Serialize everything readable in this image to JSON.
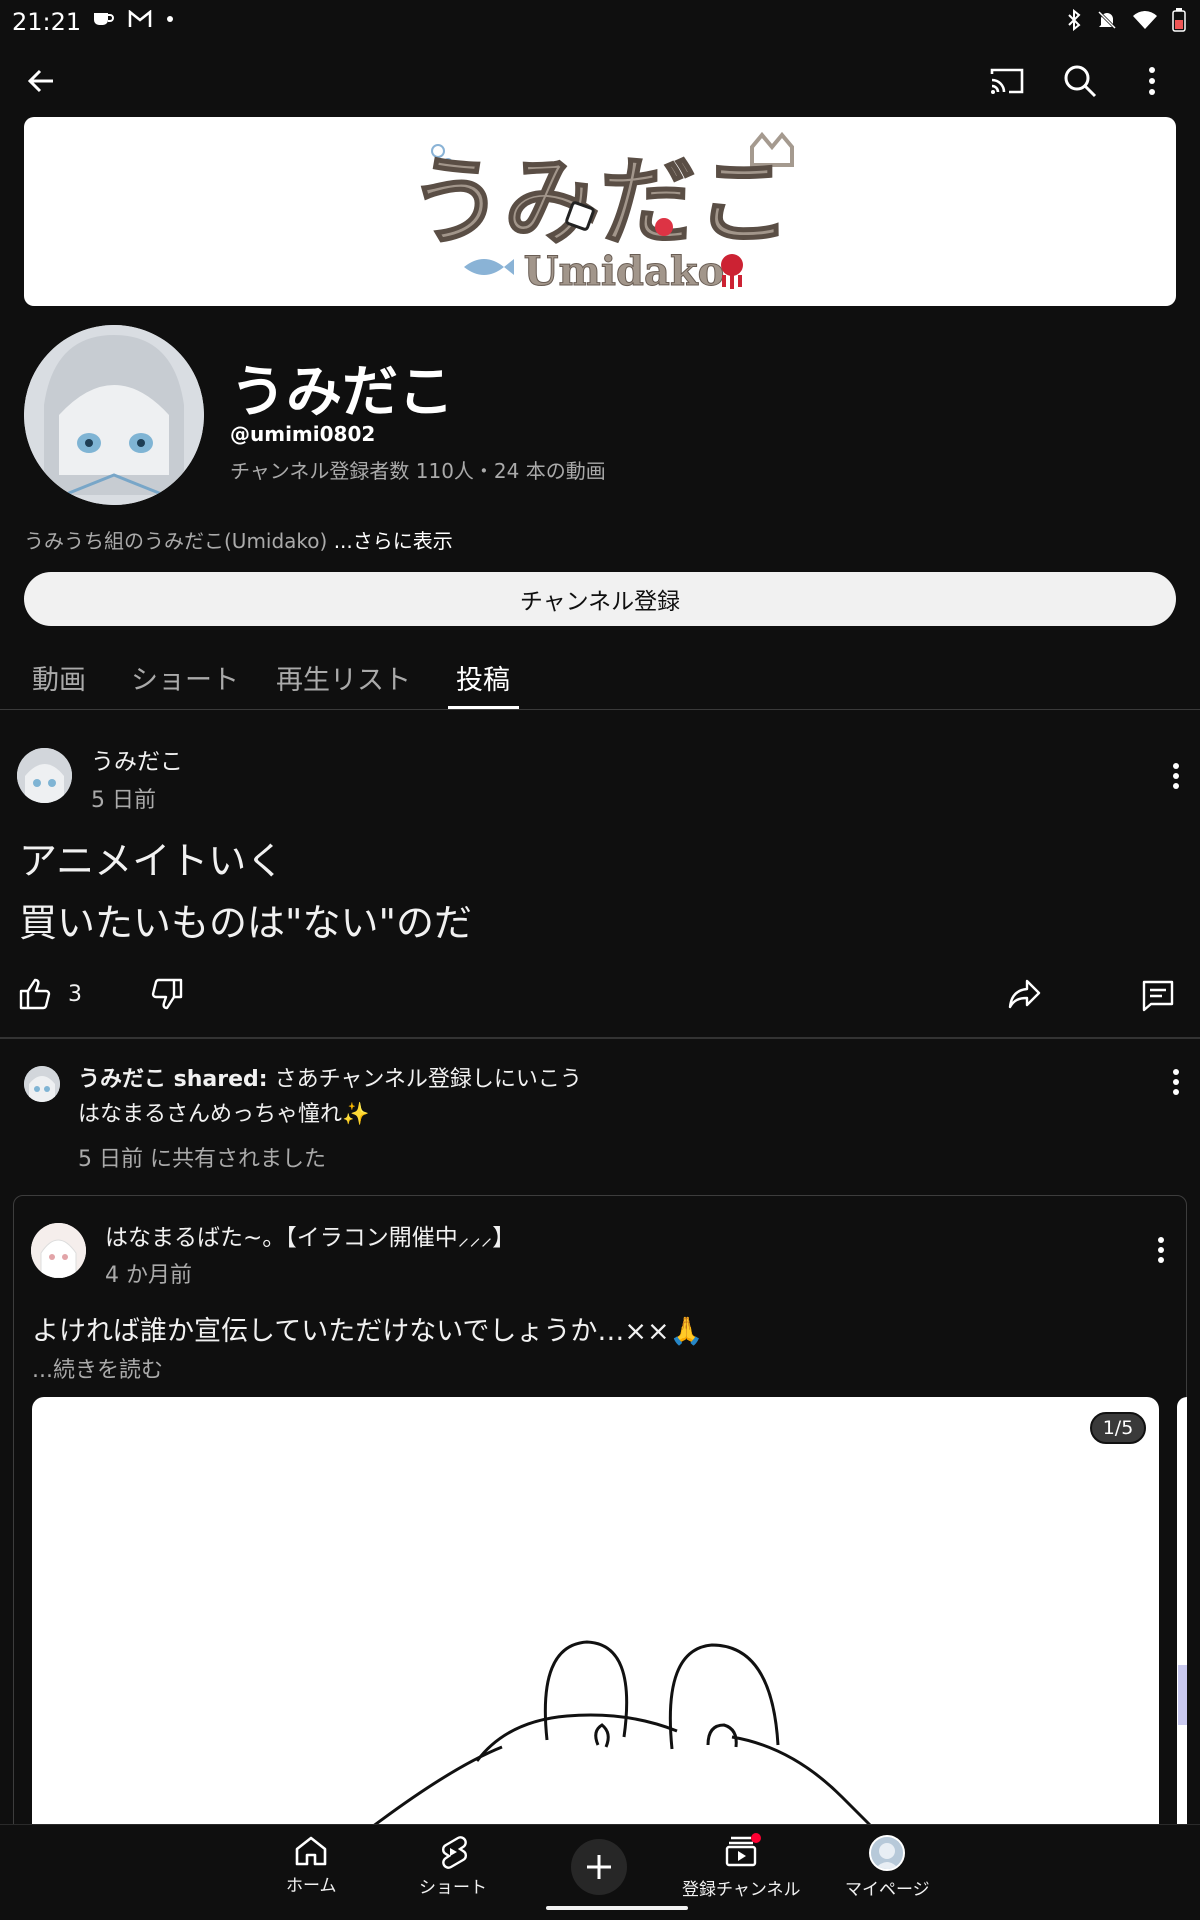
{
  "status_bar": {
    "time": "21:21"
  },
  "banner": {
    "title_jp": "うみだこ",
    "title_en": "Umidako"
  },
  "channel": {
    "name": "うみだこ",
    "handle": "@umimi0802",
    "stats": "チャンネル登録者数 110人・24 本の動画",
    "description": "うみうち組のうみだこ(Umidako) ",
    "more_label": "...さらに表示",
    "subscribe_label": "チャンネル登録"
  },
  "tabs": [
    {
      "label": "動画"
    },
    {
      "label": "ショート"
    },
    {
      "label": "再生リスト"
    },
    {
      "label": "投稿",
      "active": true
    }
  ],
  "post1": {
    "author": "うみだこ",
    "time": "5 日前",
    "lines": [
      "アニメイトいく",
      "買いたいものは\"ない\"のだ"
    ],
    "like_count": "3"
  },
  "shared_post": {
    "author_prefix": "うみだこ shared:",
    "line1_rest": " さあチャンネル登録しにいこう",
    "line2": "はなまるさんめっちゃ憧れ✨",
    "time": "5 日前 に共有されました",
    "inner": {
      "author": "はなまるばた~。【イラコン開催中⸝⸝⸝】",
      "time": "4 か月前",
      "text": "よければ誰か宣伝していただけないでしょうか…××🙏",
      "read_more": "...続きを読む",
      "image_counter": "1/5"
    }
  },
  "bottom_nav": [
    {
      "label": "ホーム",
      "icon": "home-icon"
    },
    {
      "label": "ショート",
      "icon": "shorts-icon"
    },
    {
      "label": "",
      "icon": "create-icon"
    },
    {
      "label": "登録チャンネル",
      "icon": "subscriptions-icon"
    },
    {
      "label": "マイページ",
      "icon": "profile-avatar-icon"
    }
  ],
  "colors": {
    "background": "#0f0f0f",
    "text_primary": "#f1f1f1",
    "text_secondary": "#aaaaaa",
    "button_light": "#f1f1f1",
    "notification_dot": "#ff0033"
  }
}
